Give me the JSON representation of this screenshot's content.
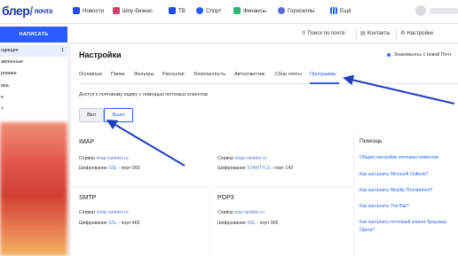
{
  "header": {
    "logo_main": "блер",
    "logo_slash": "/",
    "logo_sub": "почта",
    "nav": [
      {
        "label": "Новости",
        "icon": "news-icon",
        "color": "#1f4fe0"
      },
      {
        "label": "Шоу-бизнес",
        "icon": "showbiz-icon",
        "color": "#d13f6a"
      },
      {
        "label": "ТВ",
        "icon": "tv-icon",
        "color": "#1f4fe0"
      },
      {
        "label": "Спорт",
        "icon": "sport-icon",
        "color": "#2a5cff"
      },
      {
        "label": "Финансы",
        "icon": "finance-icon",
        "color": "#2bb673"
      },
      {
        "label": "Гороскопы",
        "icon": "horoscope-icon",
        "color": "#5a6be0"
      },
      {
        "label": "Ещё",
        "icon": "grid-icon",
        "color": "#2a5cff"
      }
    ]
  },
  "sidebar": {
    "compose_label": "НАПИСАТЬ",
    "folders": [
      {
        "label": "одящие",
        "count": "1",
        "active": true
      },
      {
        "label": "авленные",
        "count": ""
      },
      {
        "label": "ровики",
        "count": ""
      },
      {
        "label": "ика",
        "count": ""
      },
      {
        "label": "е",
        "count": ""
      },
      {
        "label": "˅",
        "count": ""
      }
    ]
  },
  "toolbar": {
    "search_label": "Поиск по почте",
    "contacts_label": "Контакты",
    "settings_label": "Настройки"
  },
  "settings": {
    "title": "Настройки",
    "notice": "Знакомьтесь с новой Почт",
    "tabs": [
      {
        "label": "Основные"
      },
      {
        "label": "Папки"
      },
      {
        "label": "Фильтры"
      },
      {
        "label": "Рассылки"
      },
      {
        "label": "Безопасность"
      },
      {
        "label": "Автоответчик"
      },
      {
        "label": "Сбор почты"
      },
      {
        "label": "Программы",
        "active": true
      }
    ],
    "description": "Доступ к почтовому ящику с помощью почтовых клиентов",
    "btn_on": "Вкл",
    "btn_off": "Выкл",
    "imap": {
      "title": "IMAP",
      "server_label": "Сервер",
      "server": "imap.rambler.ru",
      "enc1_label": "Шифрование",
      "enc1_value": "SSL",
      "enc1_port": "- порт 993",
      "server2_label": "Сервер",
      "server2": "imap.rambler.ru",
      "enc2_label": "Шифрование",
      "enc2_value": "STARTTLS",
      "enc2_port": "- порт 143"
    },
    "smtp": {
      "title": "SMTP",
      "server_label": "Сервер",
      "server": "smtp.rambler.ru",
      "enc_label": "Шифрование",
      "enc_value": "SSL",
      "enc_port": "- порт 465"
    },
    "pop3": {
      "title": "POP3",
      "server_label": "Сервер",
      "server": "pop.rambler.ru",
      "enc_label": "Шифрование",
      "enc_value": "SSL",
      "enc_port": "- порт 995"
    }
  },
  "help": {
    "title": "Помощь",
    "links": [
      "Общие настройки почтовых клиентов",
      "Как настроить Microsoft Outlook?",
      "Как настроить Mozilla Thunderbird?",
      "Как настроить The Bat?",
      "Как настроить почтовый клиент браузера",
      "Opera?"
    ]
  },
  "colors": {
    "accent": "#2a5cff",
    "arrow": "#1f3fbf"
  }
}
